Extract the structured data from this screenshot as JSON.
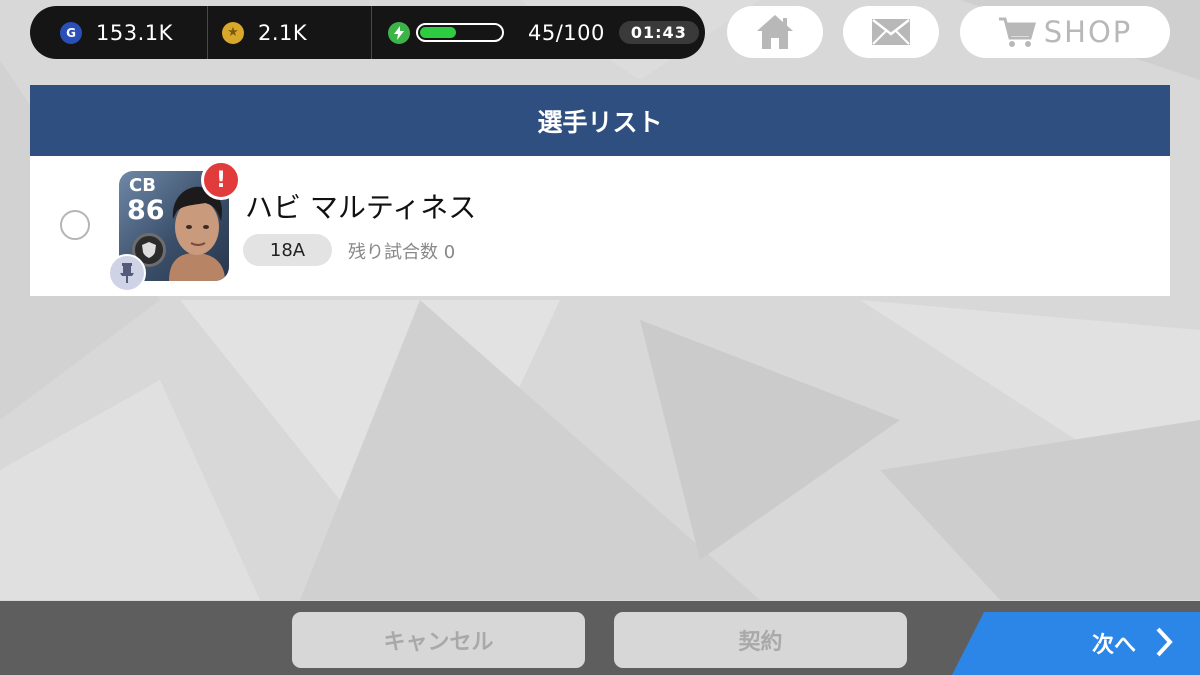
{
  "status_bar": {
    "gp_icon": "G",
    "gp_value": "153.1K",
    "coin_icon": "star-coin",
    "coin_value": "2.1K",
    "energy_icon": "lightning",
    "energy_fill_ratio": 0.45,
    "energy_text": "45/100",
    "timer": "01:43"
  },
  "top_buttons": {
    "home_icon": "home-icon",
    "mail_icon": "mail-icon",
    "shop_label": "SHOP"
  },
  "panel": {
    "title": "選手リスト",
    "player": {
      "position": "CB",
      "rating": "86",
      "name": "ハビ マルティネス",
      "alert": "!",
      "version": "18A",
      "remaining": "残り試合数 0"
    }
  },
  "bottom": {
    "cancel_label": "キャンセル",
    "contract_label": "契約",
    "next_label": "次へ"
  },
  "colors": {
    "header": "#2e4f7f",
    "next": "#2c86e8",
    "alert": "#e23b3b",
    "energy": "#2ecc40"
  }
}
